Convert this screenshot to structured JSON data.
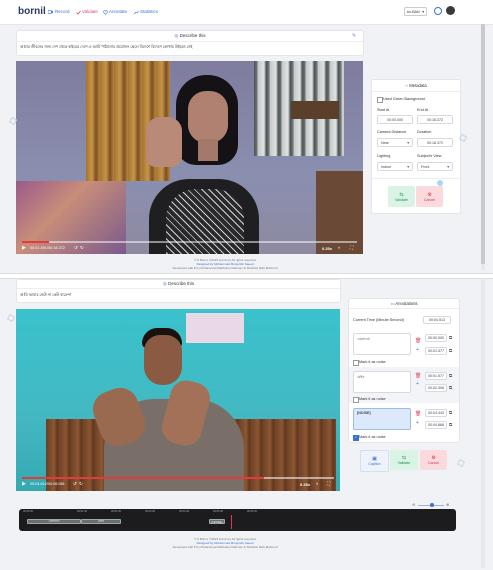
{
  "top": {
    "logo": "bornil",
    "nav": [
      {
        "label": "Record"
      },
      {
        "label": "Validate"
      },
      {
        "label": "Annotate"
      },
      {
        "label": "Statistics"
      }
    ],
    "language": "bn-BAN",
    "panel_title": "Describe this",
    "sentence": "আমার জীবনের জন্য দেশ থেকে বাইরের দেশে এ আর্মি পাঠানোর প্রয়োজন ছেলে বিদেশে বিদেশে কোথায় উইন্ডো নেই",
    "video": {
      "time": "00:01.491/00:18.372",
      "speed": "0.25x"
    },
    "metadata": {
      "title": "Metadata",
      "green_bg_label": "Used Green Background",
      "start_label": "Start At",
      "start_value": "00:00.000",
      "end_label": "End At",
      "end_value": "00:18.372",
      "distance_label": "Camera Distance",
      "distance_value": "Near",
      "duration_label": "Duration",
      "duration_value": "00:18.372",
      "lighting_label": "Lighting",
      "lighting_value": "Indoor",
      "view_label": "Subject's View",
      "view_value": "Front",
      "validate_label": "Validate",
      "cancel_label": "Cancel"
    },
    "footer": {
      "line1": "© 5 Bornil, ©2023 bornil.ai | All rights reserved",
      "line2": "Designed by Muhammad Monjurdin Saeed",
      "line3": "Developed with ♥ by Muhammad Mahbubur Rahman & Shahriar Rahi Mahmud"
    }
  },
  "bottom": {
    "panel_title": "Describe this",
    "sentence": "আমি আমার কেউ না কেউ বারেন্দা",
    "video": {
      "time": "00:04.612/00:06.981",
      "speed": "0.25x"
    },
    "annotations": {
      "title": "Annotations",
      "current_time_label": "Current Time (Minute:Second)",
      "current_time_value": "00:04.513",
      "items": [
        {
          "text": "এমলানো",
          "start": "00:00.000",
          "end": "00:01.577",
          "noise_label": "Mark it as noise",
          "noise": false
        },
        {
          "text": "মেইন",
          "start": "00:01.577",
          "end": "00:02.306",
          "noise_label": "Mark it as noise",
          "noise": false
        },
        {
          "text": "[NOISE]",
          "start": "00:04.443",
          "end": "00:04.868",
          "noise_label": "Mark it as noise",
          "noise": true
        }
      ],
      "caption_label": "Caption",
      "validate_label": "Validate",
      "cancel_label": "Cancel"
    },
    "timeline": {
      "ticks": [
        "00:00.00",
        "00:01.00",
        "00:02.00",
        "00:03.00",
        "00:04.00",
        "00:05.00",
        "00:06.00"
      ],
      "segments": [
        "এমলানো",
        "মেইন",
        "[NOISE]"
      ]
    },
    "footer": {
      "line1": "© 5 Bornil, ©2023 bornil.ai | All rights reserved",
      "line2": "Designed by Muhammad Monjurdin Saeed",
      "line3": "Developed with ♥ by Muhammad Mahbubur Rahman & Shahriar Rahi Mahmud"
    }
  },
  "colors": {
    "accent": "#e0486a",
    "blue": "#3a6fd8",
    "validate_bg": "#d9f3e4",
    "cancel_bg": "#fadadd"
  }
}
